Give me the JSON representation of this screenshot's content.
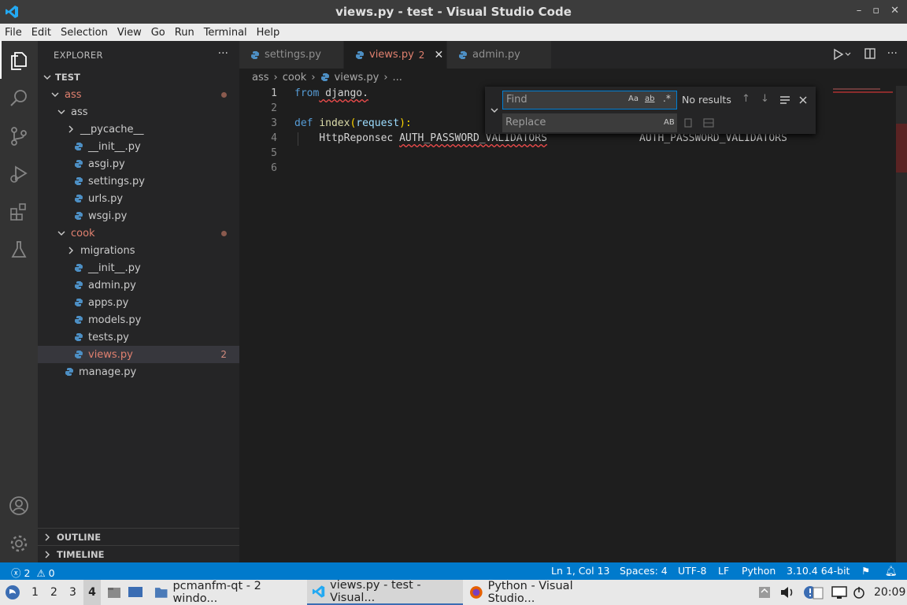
{
  "window": {
    "title": "views.py - test - Visual Studio Code",
    "controls": [
      "–",
      "▫",
      "✕"
    ]
  },
  "menu": [
    "File",
    "Edit",
    "Selection",
    "View",
    "Go",
    "Run",
    "Terminal",
    "Help"
  ],
  "sidebar": {
    "header": "EXPLORER",
    "more": "···",
    "root": "TEST",
    "tree": [
      {
        "label": "ass",
        "kind": "folder-open",
        "depth": 1,
        "color": "#e0806f",
        "dot": true
      },
      {
        "label": "ass",
        "kind": "folder-open",
        "depth": 2
      },
      {
        "label": "__pycache__",
        "kind": "folder-closed",
        "depth": 3
      },
      {
        "label": "__init__.py",
        "kind": "py",
        "depth": 3
      },
      {
        "label": "asgi.py",
        "kind": "py",
        "depth": 3
      },
      {
        "label": "settings.py",
        "kind": "py",
        "depth": 3
      },
      {
        "label": "urls.py",
        "kind": "py",
        "depth": 3
      },
      {
        "label": "wsgi.py",
        "kind": "py",
        "depth": 3
      },
      {
        "label": "cook",
        "kind": "folder-open",
        "depth": 2,
        "color": "#e0806f",
        "dot": true
      },
      {
        "label": "migrations",
        "kind": "folder-closed",
        "depth": 3
      },
      {
        "label": "__init__.py",
        "kind": "py",
        "depth": 3
      },
      {
        "label": "admin.py",
        "kind": "py",
        "depth": 3
      },
      {
        "label": "apps.py",
        "kind": "py",
        "depth": 3
      },
      {
        "label": "models.py",
        "kind": "py",
        "depth": 3
      },
      {
        "label": "tests.py",
        "kind": "py",
        "depth": 3
      },
      {
        "label": "views.py",
        "kind": "py",
        "depth": 3,
        "color": "#e0806f",
        "badge": "2",
        "selected": true
      },
      {
        "label": "manage.py",
        "kind": "py",
        "depth": 2
      }
    ],
    "outline": "OUTLINE",
    "timeline": "TIMELINE"
  },
  "tabs": [
    {
      "label": "settings.py",
      "active": false
    },
    {
      "label": "views.py",
      "active": true,
      "problems": "2",
      "close": "✕"
    },
    {
      "label": "admin.py",
      "active": false
    }
  ],
  "breadcrumb": [
    "ass",
    "cook",
    "views.py",
    "..."
  ],
  "editor": {
    "line_numbers": [
      "1",
      "2",
      "3",
      "4",
      "5",
      "6"
    ],
    "line1_kw": "from",
    "line1_rest": " django.",
    "line3_kw": "def",
    "line3_fn": "index",
    "line3_paren_open": "(",
    "line3_param": "request",
    "line3_paren_close": "):",
    "line4_indent": "    HttpReponsec ",
    "line4_squiggle": "AUTH_PASSWORD_VALIDATORS",
    "line4_tail": "AUTH_PASSWORD_VALIDATORS"
  },
  "find_widget": {
    "find_placeholder": "Find",
    "replace_placeholder": "Replace",
    "match_case": "Aa",
    "whole_word": "ab",
    "regex": ".*",
    "preserve_case": "AB",
    "status": "No results"
  },
  "statusbar": {
    "errors": "2",
    "warnings": "0",
    "position": "Ln 1, Col 13",
    "spaces": "Spaces: 4",
    "encoding": "UTF-8",
    "eol": "LF",
    "language": "Python",
    "interpreter": "3.10.4 64-bit"
  },
  "taskbar": {
    "workspaces": [
      "1",
      "2",
      "3",
      "4"
    ],
    "apps": [
      {
        "label": "pcmanfm-qt - 2 windo..."
      },
      {
        "label": "views.py - test - Visual..."
      },
      {
        "label": "Python - Visual Studio..."
      }
    ],
    "clock": "20:09"
  },
  "colors": {
    "accent": "#007acc",
    "modified": "#e0806f",
    "sidebar": "#252526",
    "editor": "#1e1e1e"
  }
}
